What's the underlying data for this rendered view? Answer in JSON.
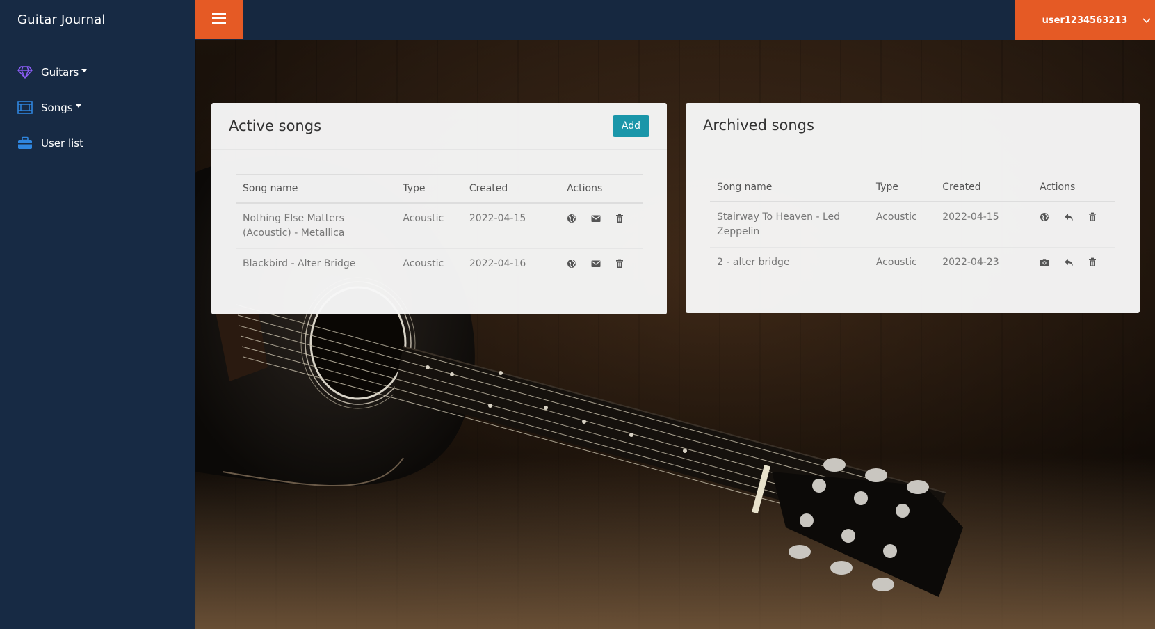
{
  "app": {
    "title": "Guitar Journal"
  },
  "sidebar": {
    "items": [
      {
        "label": "Guitars",
        "icon": "diamond-icon",
        "dropdown": true
      },
      {
        "label": "Songs",
        "icon": "image-gallery-icon",
        "dropdown": true
      },
      {
        "label": "User list",
        "icon": "briefcase-icon",
        "dropdown": false
      }
    ]
  },
  "topbar": {
    "menu_icon": "hamburger-icon",
    "username": "user1234563213"
  },
  "active_songs": {
    "title": "Active songs",
    "add_label": "Add",
    "columns": [
      "Song name",
      "Type",
      "Created",
      "Actions"
    ],
    "rows": [
      {
        "name": "Nothing Else Matters (Acoustic) - Metallica",
        "type": "Acoustic",
        "created": "2022-04-15",
        "actions": [
          "globe-icon",
          "envelope-icon",
          "trash-icon"
        ]
      },
      {
        "name": "Blackbird - Alter Bridge",
        "type": "Acoustic",
        "created": "2022-04-16",
        "actions": [
          "globe-icon",
          "envelope-icon",
          "trash-icon"
        ]
      }
    ]
  },
  "archived_songs": {
    "title": "Archived songs",
    "columns": [
      "Song name",
      "Type",
      "Created",
      "Actions"
    ],
    "rows": [
      {
        "name": "Stairway To Heaven - Led Zeppelin",
        "type": "Acoustic",
        "created": "2022-04-15",
        "actions": [
          "globe-icon",
          "reply-icon",
          "trash-icon"
        ]
      },
      {
        "name": "2 - alter bridge",
        "type": "Acoustic",
        "created": "2022-04-23",
        "actions": [
          "camera-icon",
          "reply-icon",
          "trash-icon"
        ]
      }
    ]
  },
  "colors": {
    "accent": "#e55a25",
    "sidebar": "#172a44",
    "add_button": "#1a96a9"
  }
}
